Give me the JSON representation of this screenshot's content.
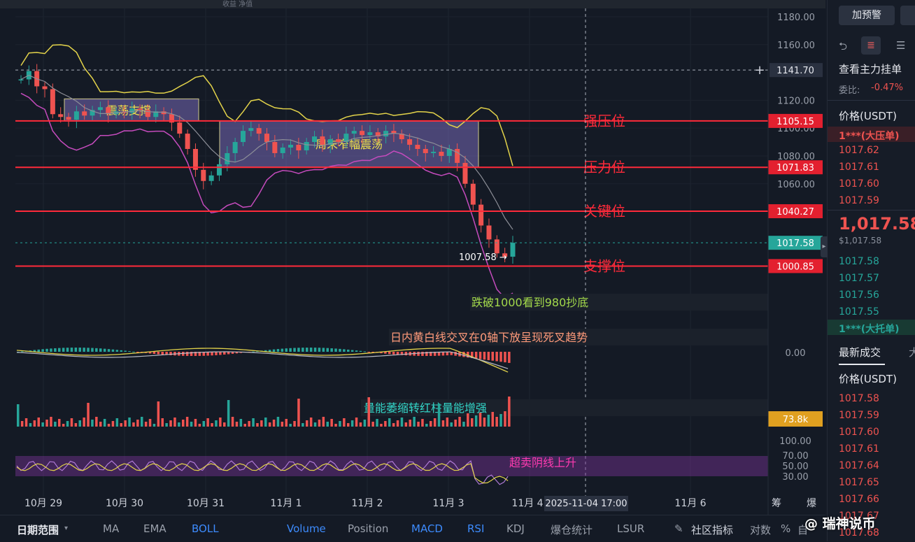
{
  "top_bar": {
    "partial_text": "收益 净值"
  },
  "chart_data": {
    "type": "line",
    "title": "",
    "x_ticks": [
      "10月 29",
      "10月 30",
      "10月 31",
      "11月 1",
      "11月 2",
      "11月 3",
      "11月 4",
      "11月 6"
    ],
    "crosshair_time": "2025-11-04 17:00",
    "ylim": [
      985,
      1185
    ],
    "y_ticks": [
      "1180.00",
      "1160.00",
      "1141.70",
      "1120.00",
      "1100.00",
      "1080.00",
      "1060.00"
    ],
    "crosshair_price": "1141.70",
    "current_price": "1017.58",
    "low_marker": "1007.58 →",
    "levels": [
      {
        "label": "强压位",
        "value": 1105.15,
        "price_tag": "1105.15"
      },
      {
        "label": "压力位",
        "value": 1071.83,
        "price_tag": "1071.83"
      },
      {
        "label": "关键位",
        "value": 1040.27,
        "price_tag": "1040.27"
      },
      {
        "label": "支撑位",
        "value": 1000.85,
        "price_tag": "1000.85"
      }
    ],
    "boxes": [
      {
        "label": "震荡支撑",
        "x_start": "10月 29 12:00",
        "x_end": "10月 31 00:00",
        "y_low": 1105,
        "y_high": 1121
      },
      {
        "label": "周末窄幅震荡",
        "x_start": "10月 31 06:00",
        "x_end": "11月 3 06:00",
        "y_low": 1072,
        "y_high": 1105
      }
    ],
    "price_series": [
      1135,
      1141,
      1130,
      1128,
      1110,
      1108,
      1106,
      1112,
      1109,
      1113,
      1115,
      1110,
      1112,
      1111,
      1114,
      1113,
      1108,
      1112,
      1110,
      1104,
      1096,
      1085,
      1070,
      1062,
      1066,
      1074,
      1082,
      1090,
      1098,
      1100,
      1096,
      1090,
      1082,
      1086,
      1088,
      1084,
      1090,
      1094,
      1088,
      1092,
      1090,
      1096,
      1098,
      1095,
      1097,
      1094,
      1098,
      1096,
      1092,
      1088,
      1085,
      1082,
      1083,
      1080,
      1085,
      1075,
      1060,
      1045,
      1030,
      1020,
      1010,
      1007.58,
      1017.58
    ],
    "annotations": {
      "price": "跌破1000看到980抄底",
      "macd": "日内黄白线交叉在0轴下放呈现死叉趋势",
      "volume": "量能萎缩转红柱量能增强",
      "rsi": "超卖阴线上升"
    },
    "macd_zero": "0.00",
    "volume_tag": "73.8k",
    "rsi_ticks": [
      "100.00",
      "70.00",
      "50.00",
      "30.00"
    ],
    "colors": {
      "up": "#26a69a",
      "down": "#ef5350",
      "level": "#ff2a3a",
      "boll": "#e3d34a",
      "box": "#8c7ad8"
    }
  },
  "indicator_bar": {
    "range_label": "日期范围",
    "tabs": [
      "MA",
      "EMA",
      "BOLL",
      "Volume",
      "Position",
      "MACD",
      "RSI",
      "KDJ",
      "爆仓统计",
      "LSUR"
    ],
    "community": "社区指标",
    "pair": "对数",
    "percent": "%",
    "auto": "自",
    "extra1": "筹",
    "extra2": "爆"
  },
  "side_panel": {
    "alert_button": "加预警",
    "order_book_title": "查看主力挂单",
    "ratio_label": "委比:",
    "ratio_value": "-0.47%",
    "price_header": "价格(USDT)",
    "big_ask": "1***(大压单)",
    "asks": [
      "1017.62",
      "1017.61",
      "1017.60",
      "1017.59"
    ],
    "last_price": "1,017.58",
    "last_usd": "$1,017.58",
    "bids": [
      "1017.58",
      "1017.57",
      "1017.56",
      "1017.55"
    ],
    "big_bid": "1***(大托单)",
    "trades_tab": "最新成交",
    "trades_tab2": "大",
    "trades_header": "价格(USDT)",
    "trades": [
      "1017.58",
      "1017.59",
      "1017.60",
      "1017.61",
      "1017.64",
      "1017.65",
      "1017.66",
      "1017.67",
      "1017.68"
    ]
  },
  "watermark": "@ 瑞神说币"
}
